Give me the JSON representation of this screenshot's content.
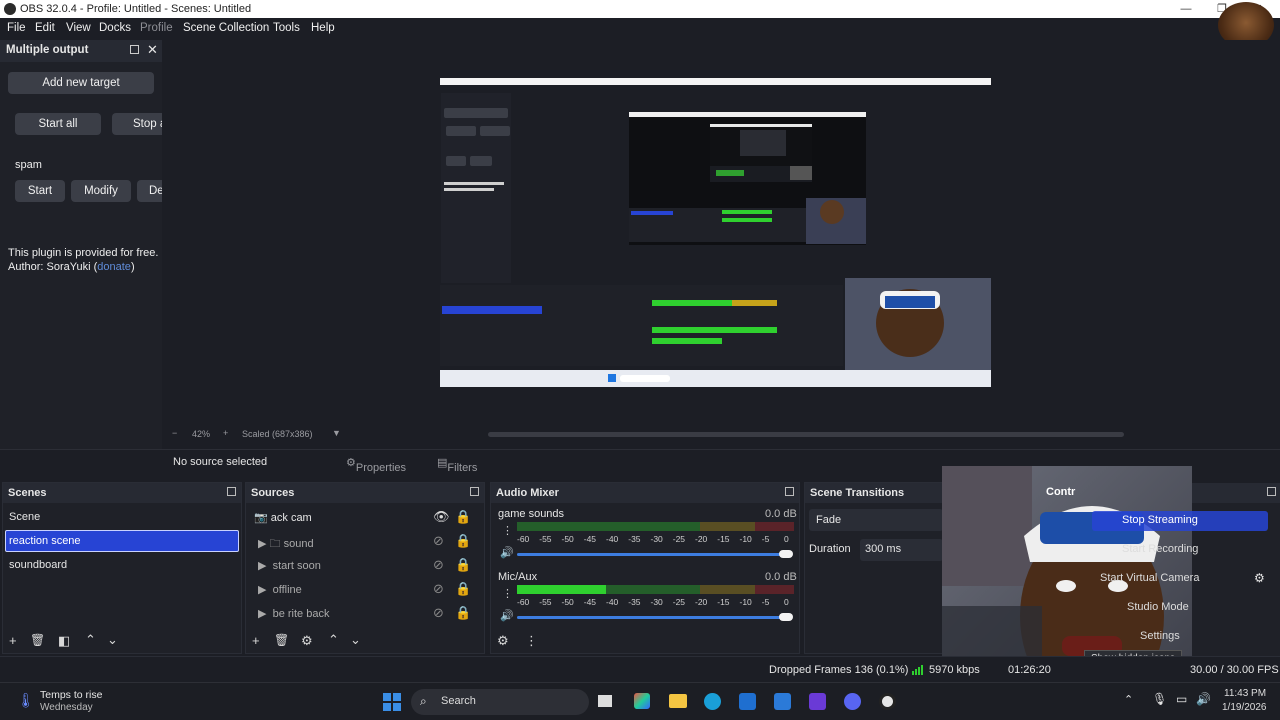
{
  "window": {
    "title": "OBS 32.0.4 - Profile: Untitled - Scenes: Untitled",
    "controls": [
      "—",
      "❐",
      "✕"
    ]
  },
  "menu": [
    "File",
    "Edit",
    "View",
    "Docks",
    "Profile",
    "Scene Collection",
    "Tools",
    "Help"
  ],
  "multiple_output": {
    "title": "Multiple output",
    "add_target": "Add new target",
    "start_all": "Start all",
    "stop_all": "Stop a",
    "target_name": "spam",
    "start": "Start",
    "modify": "Modify",
    "delete": "De",
    "info_line": "This plugin is provided for free.",
    "author_prefix": "Author: SoraYuki (",
    "donate": "donate",
    "author_suffix": ")"
  },
  "preview": {
    "zoom": "42%",
    "scale_mode": "Scaled (687x386)"
  },
  "context": {
    "selection": "No source selected",
    "properties": "Properties",
    "filters": "Filters"
  },
  "scenes": {
    "title": "Scenes",
    "items": [
      "Scene",
      "reaction scene",
      "soundboard"
    ],
    "selected": "reaction scene"
  },
  "sources": {
    "title": "Sources",
    "items": [
      "ack cam",
      "sound",
      "start soon",
      "offline",
      "be rite back"
    ]
  },
  "audio_mixer": {
    "title": "Audio Mixer",
    "channels": [
      {
        "name": "game sounds",
        "db": "0.0 dB",
        "level": 0.0
      },
      {
        "name": "Mic/Aux",
        "db": "0.0 dB",
        "level": 0.32
      }
    ],
    "scale": [
      "-60",
      "-55",
      "-50",
      "-45",
      "-40",
      "-35",
      "-30",
      "-25",
      "-20",
      "-15",
      "-10",
      "-5",
      "0"
    ]
  },
  "transitions": {
    "title": "Scene Transitions",
    "type": "Fade",
    "duration_label": "Duration",
    "duration_value": "300 ms"
  },
  "controls": {
    "title": "Contr",
    "stop_streaming": "Stop Streaming",
    "start_recording": "Start Recording",
    "virtual_camera": "Start Virtual Camera",
    "studio_mode": "Studio Mode",
    "settings": "Settings",
    "tooltip": "Show hidden icons"
  },
  "status": {
    "dropped": "Dropped Frames 136 (0.1%)",
    "bitrate": "5970 kbps",
    "stream_time": "01:26:20",
    "fps": "30.00 / 30.00 FPS"
  },
  "taskbar": {
    "weather_line1": "Temps to rise",
    "weather_line2": "Wednesday",
    "search": "Search",
    "time": "11:43 PM",
    "date": "1/19/2026"
  },
  "colors": {
    "accent": "#2744d4",
    "bg": "#1c1e25",
    "panel": "#1f2128",
    "meter_green": "#2fd02f",
    "meter_yellow": "#c6a31a",
    "meter_red": "#c8282a"
  }
}
